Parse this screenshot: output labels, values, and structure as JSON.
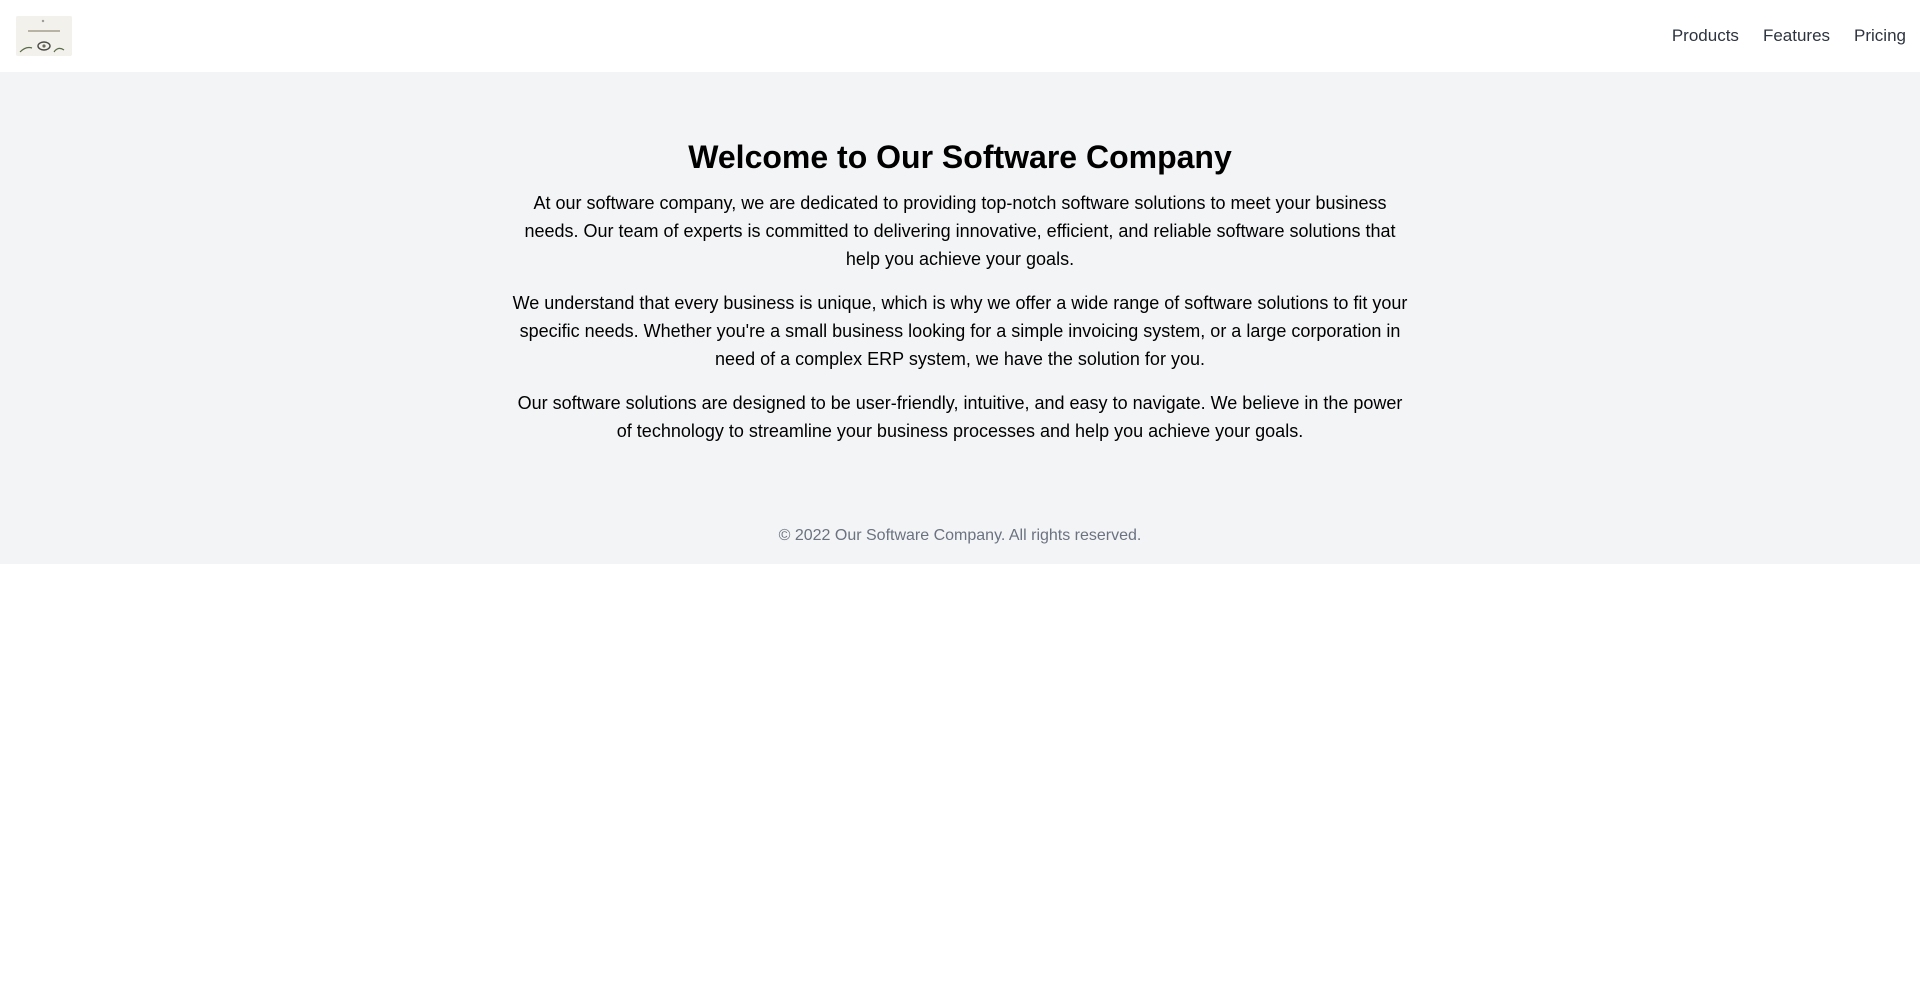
{
  "header": {
    "logo_icon": "company-logo-image",
    "nav": {
      "products": "Products",
      "features": "Features",
      "pricing": "Pricing"
    }
  },
  "main": {
    "title": "Welcome to Our Software Company",
    "paragraphs": [
      "At our software company, we are dedicated to providing top-notch software solutions to meet your business needs. Our team of experts is committed to delivering innovative, efficient, and reliable software solutions that help you achieve your goals.",
      "We understand that every business is unique, which is why we offer a wide range of software solutions to fit your specific needs. Whether you're a small business looking for a simple invoicing system, or a large corporation in need of a complex ERP system, we have the solution for you.",
      "Our software solutions are designed to be user-friendly, intuitive, and easy to navigate. We believe in the power of technology to streamline your business processes and help you achieve your goals."
    ]
  },
  "footer": {
    "copyright": "© 2022 Our Software Company. All rights reserved."
  },
  "colors": {
    "page_background": "#ffffff",
    "section_background": "#f3f4f6",
    "nav_text": "#2d3440",
    "footer_text": "#6b7280"
  }
}
